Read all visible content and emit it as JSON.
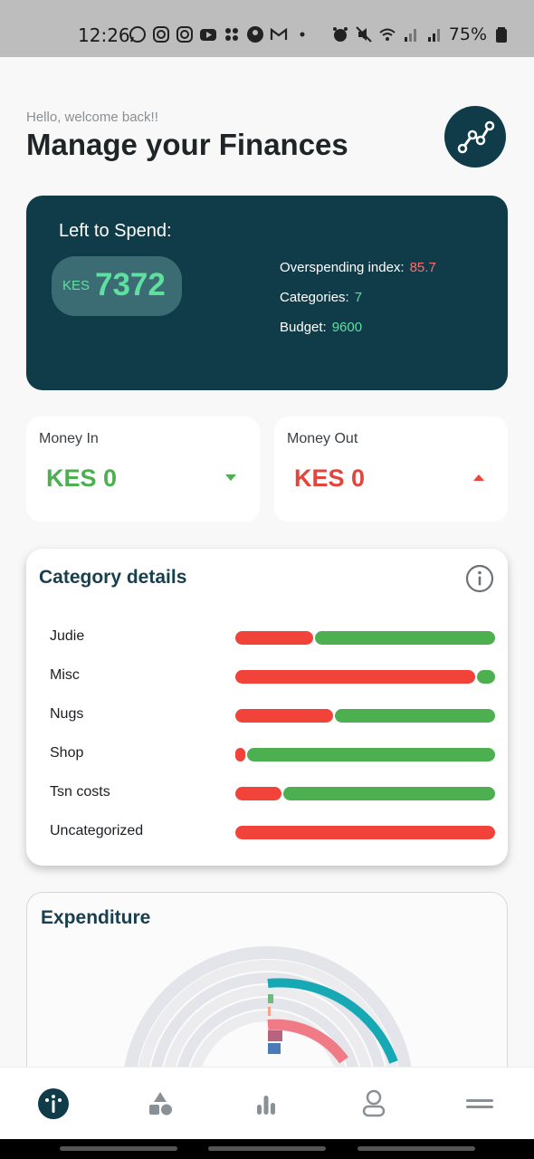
{
  "status": {
    "time": "12:26",
    "battery": "75%"
  },
  "header": {
    "greeting": "Hello, welcome back!!",
    "title": "Manage your Finances",
    "logo_icon": "chart-line-icon"
  },
  "spend": {
    "title": "Left to Spend:",
    "currency": "KES",
    "amount": "7372",
    "stats": [
      {
        "label": "Overspending index:",
        "value": "85.7"
      },
      {
        "label": "Categories:",
        "value": "7"
      },
      {
        "label": "Budget:",
        "value": "9600"
      }
    ]
  },
  "money_in": {
    "label": "Money In",
    "value": "KES 0",
    "color": "#4caf50",
    "icon": "caret-down-icon"
  },
  "money_out": {
    "label": "Money Out",
    "value": "KES 0",
    "color": "#f2433b",
    "icon": "caret-up-icon"
  },
  "categories": {
    "title": "Category details",
    "info_icon": "info-icon",
    "items": [
      {
        "name": "Judie",
        "spent_fraction": 0.3
      },
      {
        "name": "Misc",
        "spent_fraction": 0.93
      },
      {
        "name": "Nugs",
        "spent_fraction": 0.38
      },
      {
        "name": "Shop",
        "spent_fraction": 0.04
      },
      {
        "name": "Tsn costs",
        "spent_fraction": 0.18
      },
      {
        "name": "Uncategorized",
        "spent_fraction": 1.0
      }
    ],
    "colors": {
      "spent": "#f2433b",
      "remaining": "#4caf50"
    }
  },
  "expenditure": {
    "title": "Expenditure"
  },
  "nav": {
    "items": [
      {
        "icon": "dashboard-icon",
        "active": true
      },
      {
        "icon": "categories-icon",
        "active": false
      },
      {
        "icon": "stats-icon",
        "active": false
      },
      {
        "icon": "profile-icon",
        "active": false
      },
      {
        "icon": "menu-icon",
        "active": false
      }
    ]
  }
}
